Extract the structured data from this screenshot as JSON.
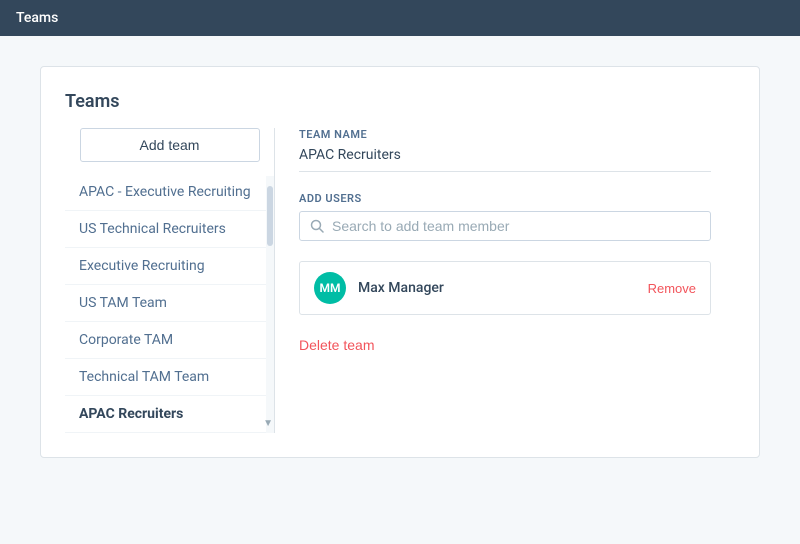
{
  "topBar": {
    "title": "Teams"
  },
  "card": {
    "title": "Teams"
  },
  "addTeam": {
    "label": "Add team"
  },
  "teamList": [
    {
      "id": "apac-exec",
      "label": "APAC - Executive Recruiting",
      "active": false
    },
    {
      "id": "us-tech-rec",
      "label": "US Technical Recruiters",
      "active": false
    },
    {
      "id": "exec-rec",
      "label": "Executive Recruiting",
      "active": false
    },
    {
      "id": "us-tam",
      "label": "US TAM Team",
      "active": false
    },
    {
      "id": "corporate-tam",
      "label": "Corporate TAM",
      "active": false
    },
    {
      "id": "tech-tam",
      "label": "Technical TAM Team",
      "active": false
    },
    {
      "id": "apac-recruiters",
      "label": "APAC Recruiters",
      "active": true
    }
  ],
  "rightPanel": {
    "teamNameLabel": "TEAM NAME",
    "teamNameValue": "APAC Recruiters",
    "addUsersLabel": "ADD USERS",
    "searchPlaceholder": "Search to add team member",
    "user": {
      "initials": "MM",
      "name": "Max Manager",
      "removeLabel": "Remove"
    },
    "deleteLabel": "Delete team"
  }
}
